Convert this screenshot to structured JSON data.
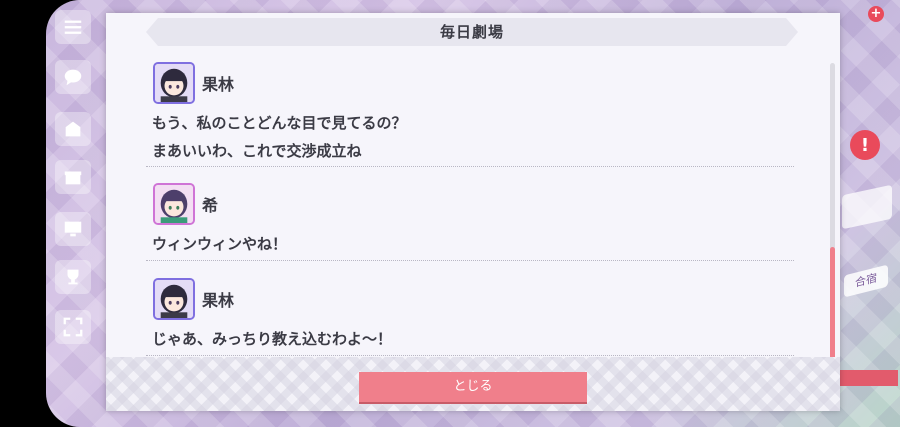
{
  "modal": {
    "title": "毎日劇場",
    "close_label": "とじる"
  },
  "dialogue": [
    {
      "speaker": "果林",
      "avatar": "karin",
      "lines": [
        "もう、私のことどんな目で見てるの？",
        "まあいいわ、これで交渉成立ね"
      ]
    },
    {
      "speaker": "希",
      "avatar": "nozomi",
      "lines": [
        "ウィンウィンやね！"
      ]
    },
    {
      "speaker": "果林",
      "avatar": "karin",
      "lines": [
        "じゃあ、みっちり教え込むわよ～！"
      ]
    }
  ],
  "background": {
    "right_label": "合宿"
  },
  "colors": {
    "accent": "#f07f8b",
    "karin_frame": "#7f6fe0",
    "nozomi_frame": "#cf74d6",
    "text": "#3b3b45",
    "modal_bg": "#f6f5fb"
  },
  "icons": [
    "menu-icon",
    "chat-icon",
    "event-icon",
    "gift-icon",
    "monitor-icon",
    "trophy-icon",
    "fullscreen-icon",
    "close-plus-icon"
  ]
}
